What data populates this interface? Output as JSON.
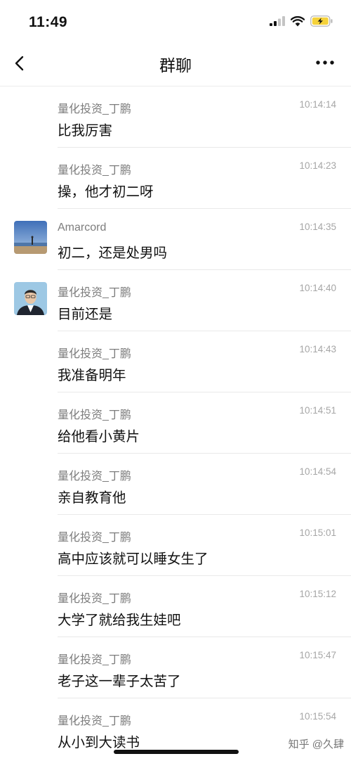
{
  "status_bar": {
    "time": "11:49",
    "battery_color": "#f5d23a",
    "icons": [
      "signal-icon",
      "wifi-icon",
      "battery-charging-icon"
    ]
  },
  "nav": {
    "title": "群聊",
    "back_icon": "chevron-left-icon",
    "more_icon": "more-dots-icon"
  },
  "messages": [
    {
      "sender": "量化投资_丁鹏",
      "time": "10:14:14",
      "text": "比我厉害",
      "avatar": null
    },
    {
      "sender": "量化投资_丁鹏",
      "time": "10:14:23",
      "text": "操，他才初二呀",
      "avatar": null
    },
    {
      "sender": "Amarcord",
      "time": "10:14:35",
      "text": "初二，还是处男吗",
      "avatar": "landscape-avatar"
    },
    {
      "sender": "量化投资_丁鹏",
      "time": "10:14:40",
      "text": "目前还是",
      "avatar": "portrait-avatar"
    },
    {
      "sender": "量化投资_丁鹏",
      "time": "10:14:43",
      "text": "我准备明年",
      "avatar": null
    },
    {
      "sender": "量化投资_丁鹏",
      "time": "10:14:51",
      "text": "给他看小黄片",
      "avatar": null
    },
    {
      "sender": "量化投资_丁鹏",
      "time": "10:14:54",
      "text": "亲自教育他",
      "avatar": null
    },
    {
      "sender": "量化投资_丁鹏",
      "time": "10:15:01",
      "text": "高中应该就可以睡女生了",
      "avatar": null
    },
    {
      "sender": "量化投资_丁鹏",
      "time": "10:15:12",
      "text": "大学了就给我生娃吧",
      "avatar": null
    },
    {
      "sender": "量化投资_丁鹏",
      "time": "10:15:47",
      "text": "老子这一辈子太苦了",
      "avatar": null
    },
    {
      "sender": "量化投资_丁鹏",
      "time": "10:15:54",
      "text": "从小到大读书",
      "avatar": null
    }
  ],
  "watermark": "知乎 @久肆"
}
